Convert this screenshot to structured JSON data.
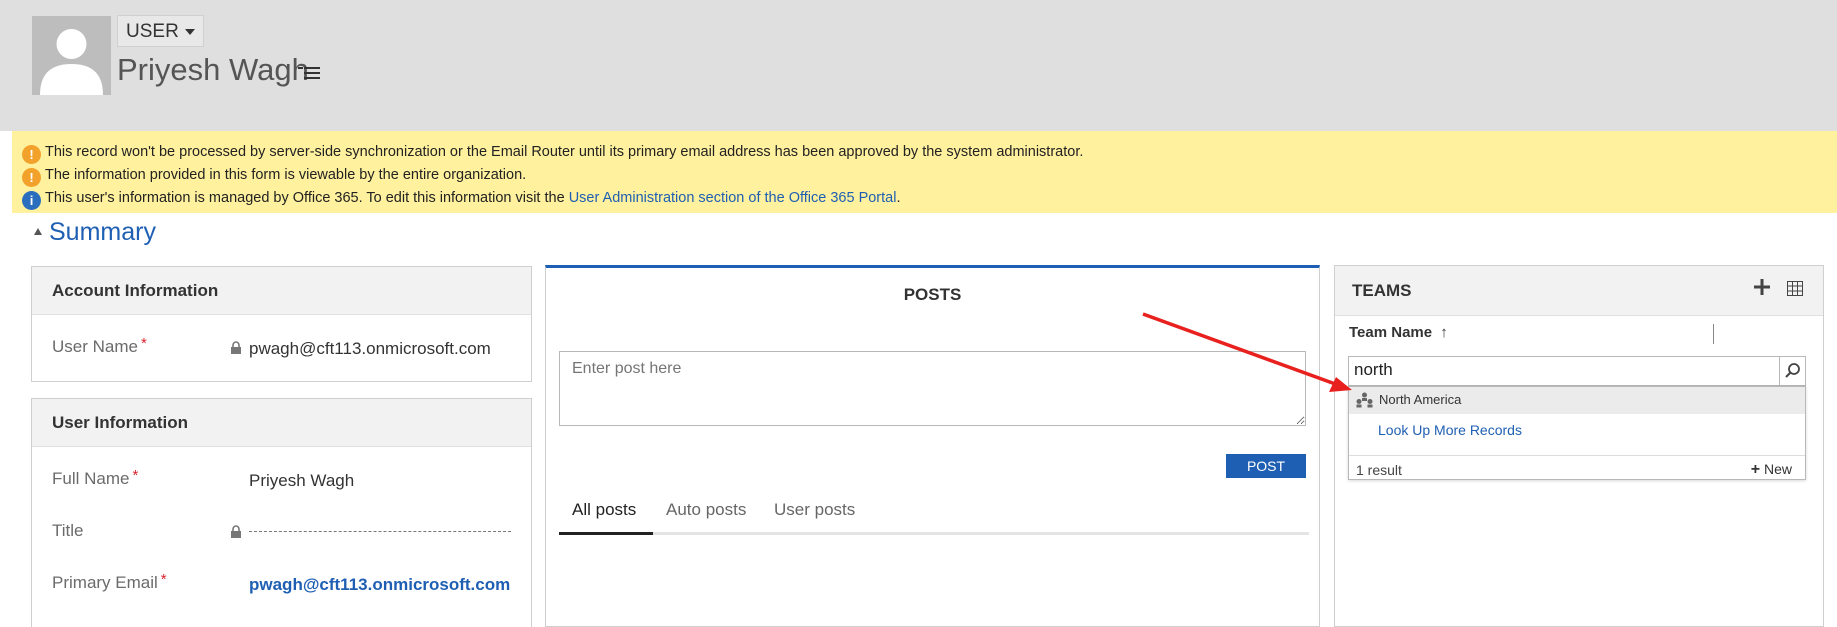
{
  "header": {
    "entity_label": "USER",
    "full_name": "Priyesh Wagh"
  },
  "notifications": [
    {
      "type": "warning",
      "text": "This record won't be processed by server-side synchronization or the Email Router until its primary email address has been approved by the system administrator."
    },
    {
      "type": "warning",
      "text": "The information provided in this form is viewable by the entire organization."
    },
    {
      "type": "info",
      "text": "This user's information is managed by Office 365. To edit this information visit the ",
      "link": "User Administration section of the Office 365 Portal",
      "suffix": "."
    }
  ],
  "section_title": "Summary",
  "account_info": {
    "heading": "Account Information",
    "user_name_label": "User Name",
    "user_name_value": "pwagh@cft113.onmicrosoft.com"
  },
  "user_info": {
    "heading": "User Information",
    "full_name_label": "Full Name",
    "full_name_value": "Priyesh Wagh",
    "title_label": "Title",
    "primary_email_label": "Primary Email",
    "primary_email_value": "pwagh@cft113.onmicrosoft.com"
  },
  "posts": {
    "title": "POSTS",
    "placeholder": "Enter post here",
    "post_button": "POST",
    "tabs": [
      "All posts",
      "Auto posts",
      "User posts"
    ]
  },
  "teams": {
    "heading": "TEAMS",
    "column_header": "Team Name",
    "search_value": "north",
    "result_item": "North America",
    "look_up_more": "Look Up More Records",
    "result_count": "1 result",
    "new_label": "New"
  },
  "colors": {
    "accent": "#1f5fb3",
    "notification_bg": "#fff19e",
    "annotation_arrow": "#e8201e"
  }
}
